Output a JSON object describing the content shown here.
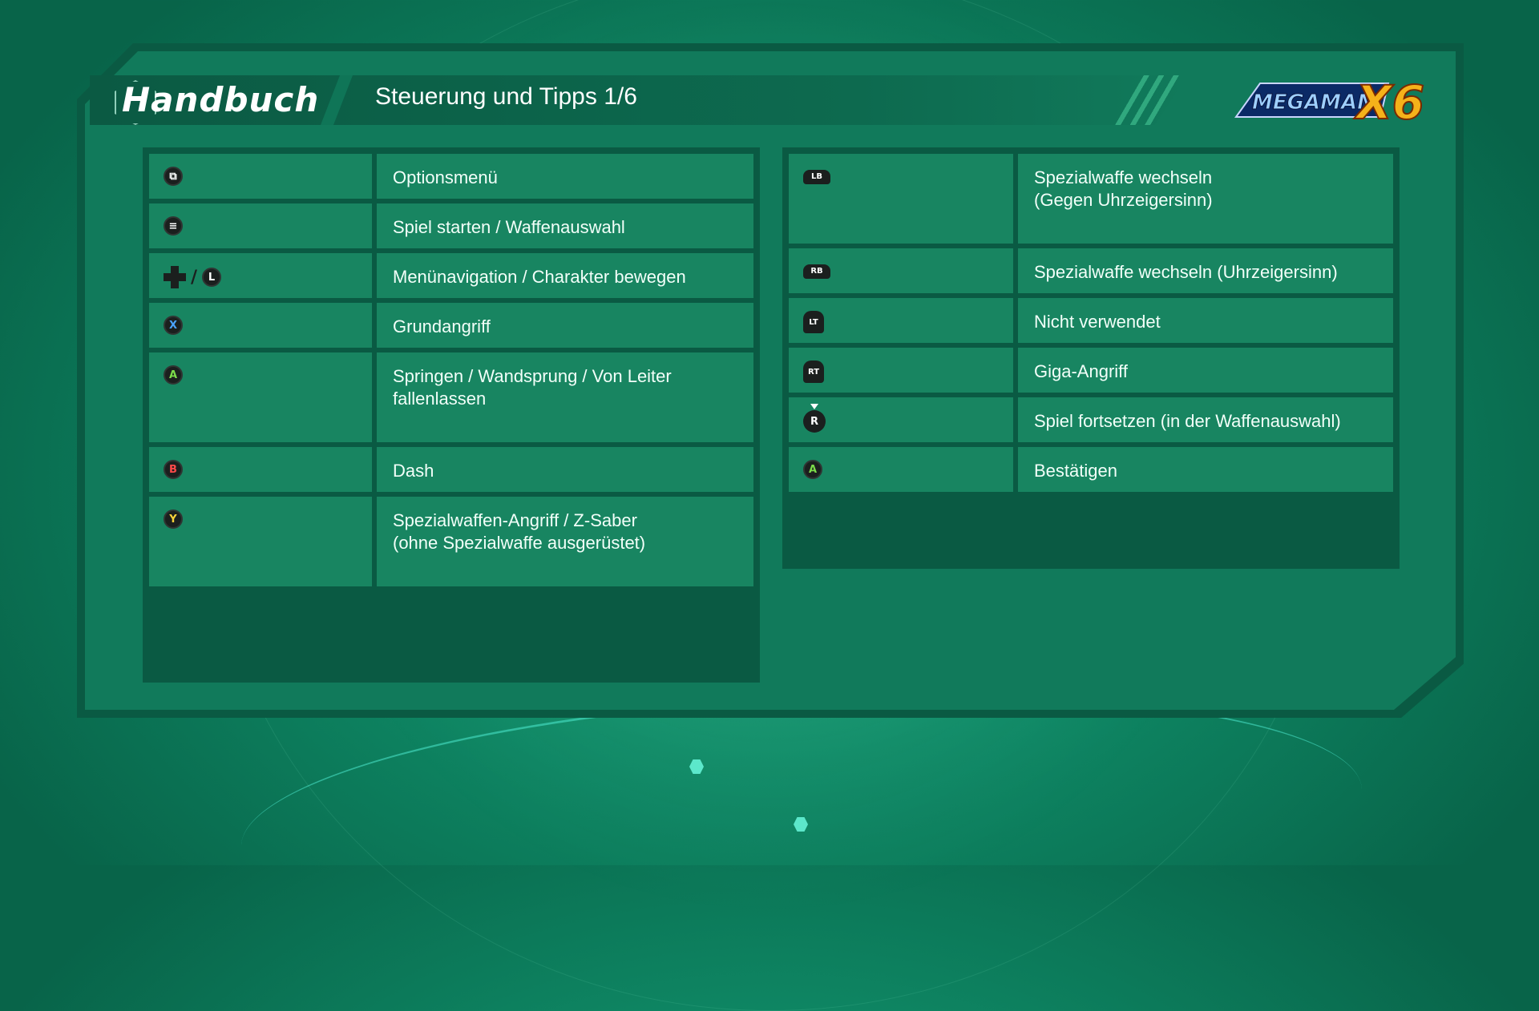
{
  "header": {
    "section_title": "Handbuch",
    "page_title": "Steuerung und Tipps 1/6",
    "logo_text": "MEGAMAN",
    "logo_number": "X6"
  },
  "left_table": [
    {
      "icon": "view-button-icon",
      "glyph": "⧉",
      "action": "Optionsmenü",
      "height": 56
    },
    {
      "icon": "menu-button-icon",
      "glyph": "≡",
      "action": "Spiel starten / Waffenauswahl",
      "height": 56
    },
    {
      "icon": "dpad-left-stick-icon",
      "glyph": "L",
      "action": "Menünavigation / Charakter bewegen",
      "height": 56
    },
    {
      "icon": "x-button-icon",
      "glyph": "X",
      "action": "Grundangriff",
      "height": 56
    },
    {
      "icon": "a-button-icon",
      "glyph": "A",
      "action": "Springen / Wandsprung / Von Leiter\nfallenlassen",
      "height": 112
    },
    {
      "icon": "b-button-icon",
      "glyph": "B",
      "action": "Dash",
      "height": 56
    },
    {
      "icon": "y-button-icon",
      "glyph": "Y",
      "action": "Spezialwaffen-Angriff / Z-Saber\n(ohne Spezialwaffe ausgerüstet)",
      "height": 112
    }
  ],
  "right_table": [
    {
      "icon": "lb-button-icon",
      "glyph": "LB",
      "action": "Spezialwaffe wechseln\n(Gegen Uhrzeigersinn)"
    },
    {
      "icon": "rb-button-icon",
      "glyph": "RB",
      "action": "Spezialwaffe wechseln (Uhrzeigersinn)"
    },
    {
      "icon": "lt-button-icon",
      "glyph": "LT",
      "action": "Nicht verwendet"
    },
    {
      "icon": "rt-button-icon",
      "glyph": "RT",
      "action": "Giga-Angriff"
    },
    {
      "icon": "right-stick-press-icon",
      "glyph": "R",
      "action": "Spiel fortsetzen (in der Waffenauswahl)"
    },
    {
      "icon": "a-button-icon",
      "glyph": "A",
      "action": "Bestätigen"
    }
  ],
  "colors": {
    "background": "#0f8a66",
    "frame": "#0a5a43",
    "cell": "#1e966e",
    "x_button": "#4aa3ff",
    "a_button": "#7cdc4a",
    "b_button": "#ff4a4a",
    "y_button": "#f6d23a"
  }
}
